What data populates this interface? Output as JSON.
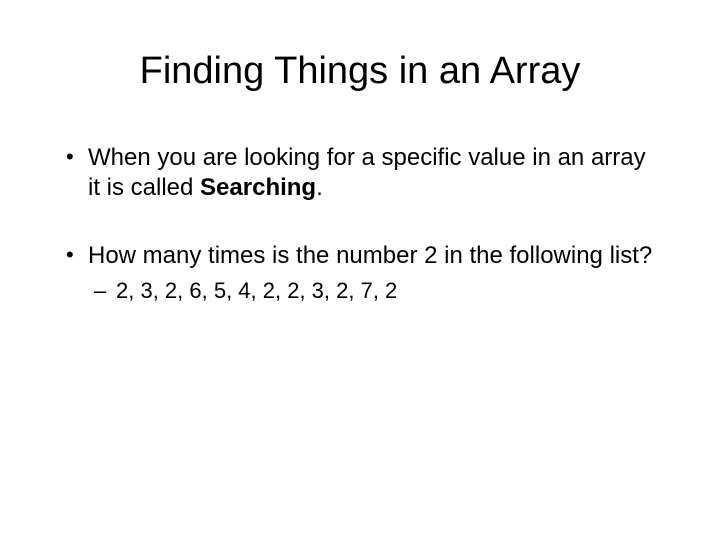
{
  "title": "Finding Things in an Array",
  "bullets": [
    {
      "text_before": "When you are looking for a specific value in an array it is called ",
      "bold": "Searching",
      "text_after": "."
    },
    {
      "text": "How many times is the number 2 in the following list?",
      "sub": [
        "2, 3, 2, 6, 5, 4, 2, 2, 3, 2, 7, 2"
      ]
    }
  ]
}
